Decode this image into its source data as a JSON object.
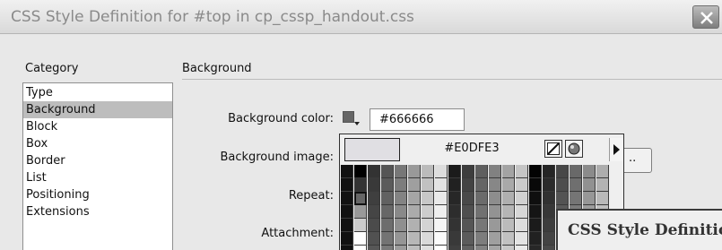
{
  "window": {
    "title": "CSS Style Definition for #top in cp_cssp_handout.css",
    "close_icon": "close-icon"
  },
  "category": {
    "label": "Category",
    "items": [
      "Type",
      "Background",
      "Block",
      "Box",
      "Border",
      "List",
      "Positioning",
      "Extensions"
    ],
    "selected": "Background"
  },
  "background": {
    "section_title": "Background",
    "color_label": "Background color:",
    "color_value": "#666666",
    "swatch_color": "#666666",
    "image_label": "Background image:",
    "browse_label": "..",
    "repeat_label": "Repeat:",
    "attachment_label": "Attachment:"
  },
  "picker": {
    "hex": "#E0DFE3",
    "preview_color": "#E0DFE3",
    "tools": [
      "no-color-icon",
      "system-color-icon"
    ],
    "menu_icon": "flyout-arrow-icon"
  },
  "sub_dialog": {
    "title": "CSS Style Definition"
  }
}
